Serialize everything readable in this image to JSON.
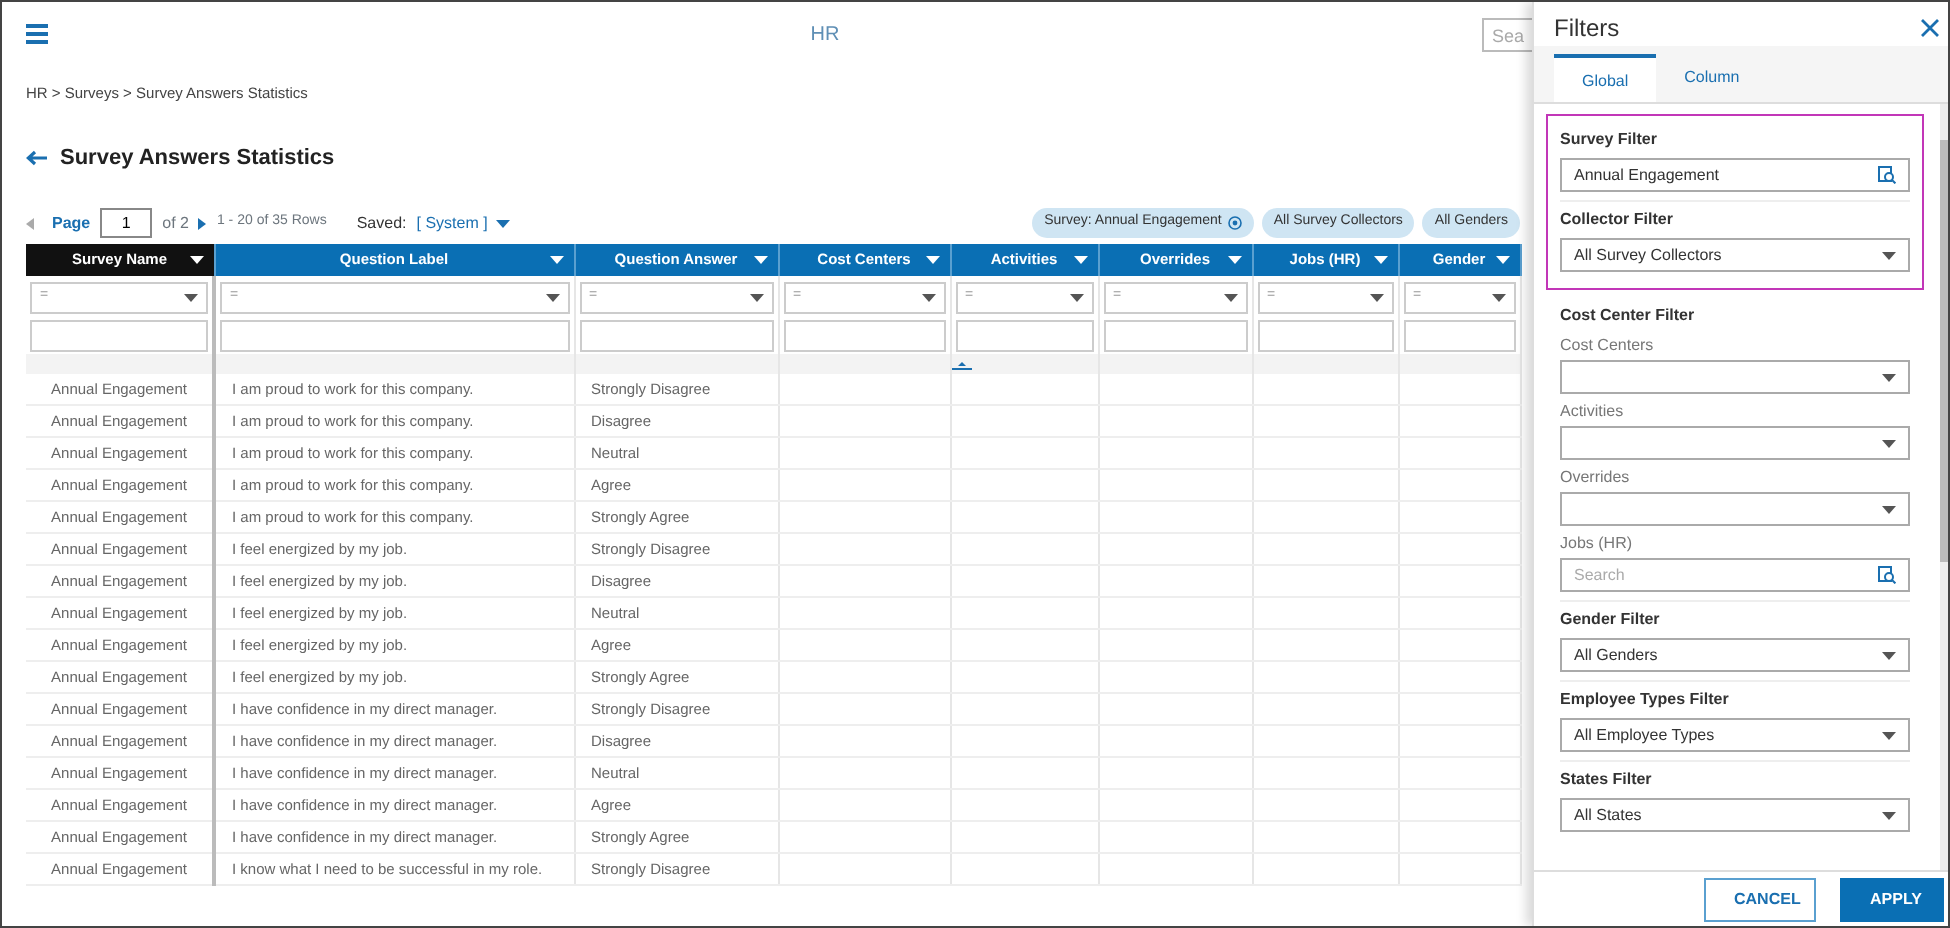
{
  "header": {
    "title": "HR",
    "search": {
      "placeholder": "Sea"
    }
  },
  "breadcrumb": "HR > Surveys > Survey Answers Statistics",
  "page_title": "Survey Answers Statistics",
  "pager": {
    "label": "Page",
    "page": "1",
    "of": "of 2",
    "rows": "1 - 20 of 35 Rows",
    "saved_label": "Saved:",
    "saved_value": "[ System ]"
  },
  "chips": [
    {
      "label": "Survey: Annual Engagement",
      "removable": true
    },
    {
      "label": "All Survey Collectors",
      "removable": false
    },
    {
      "label": "All Genders",
      "removable": false
    }
  ],
  "table": {
    "columns": [
      {
        "label": "Survey Name",
        "selected": true,
        "operator": "="
      },
      {
        "label": "Question Label",
        "selected": false,
        "operator": "="
      },
      {
        "label": "Question Answer",
        "selected": false,
        "operator": "="
      },
      {
        "label": "Cost Centers",
        "selected": false,
        "operator": "="
      },
      {
        "label": "Activities",
        "selected": false,
        "operator": "="
      },
      {
        "label": "Overrides",
        "selected": false,
        "operator": "="
      },
      {
        "label": "Jobs (HR)",
        "selected": false,
        "operator": "="
      },
      {
        "label": "Gender",
        "selected": false,
        "operator": "="
      }
    ],
    "rows": [
      [
        "Annual Engagement",
        "I am proud to work for this company.",
        "Strongly Disagree"
      ],
      [
        "Annual Engagement",
        "I am proud to work for this company.",
        "Disagree"
      ],
      [
        "Annual Engagement",
        "I am proud to work for this company.",
        "Neutral"
      ],
      [
        "Annual Engagement",
        "I am proud to work for this company.",
        "Agree"
      ],
      [
        "Annual Engagement",
        "I am proud to work for this company.",
        "Strongly Agree"
      ],
      [
        "Annual Engagement",
        "I feel energized by my job.",
        "Strongly Disagree"
      ],
      [
        "Annual Engagement",
        "I feel energized by my job.",
        "Disagree"
      ],
      [
        "Annual Engagement",
        "I feel energized by my job.",
        "Neutral"
      ],
      [
        "Annual Engagement",
        "I feel energized by my job.",
        "Agree"
      ],
      [
        "Annual Engagement",
        "I feel energized by my job.",
        "Strongly Agree"
      ],
      [
        "Annual Engagement",
        "I have confidence in my direct manager.",
        "Strongly Disagree"
      ],
      [
        "Annual Engagement",
        "I have confidence in my direct manager.",
        "Disagree"
      ],
      [
        "Annual Engagement",
        "I have confidence in my direct manager.",
        "Neutral"
      ],
      [
        "Annual Engagement",
        "I have confidence in my direct manager.",
        "Agree"
      ],
      [
        "Annual Engagement",
        "I have confidence in my direct manager.",
        "Strongly Agree"
      ],
      [
        "Annual Engagement",
        "I know what I need to be successful in my role.",
        "Strongly Disagree"
      ]
    ]
  },
  "filters_panel": {
    "title": "Filters",
    "tabs": [
      {
        "label": "Global",
        "selected": true
      },
      {
        "label": "Column",
        "selected": false
      }
    ],
    "highlighted_sections": [
      {
        "heading": "Survey Filter",
        "fields": [
          {
            "kind": "search",
            "value": "Annual Engagement"
          }
        ]
      },
      {
        "heading": "Collector Filter",
        "fields": [
          {
            "kind": "select",
            "value": "All Survey Collectors"
          }
        ]
      }
    ],
    "sections": [
      {
        "heading": "Cost Center Filter",
        "fields": [
          {
            "kind": "select",
            "label": "Cost Centers"
          },
          {
            "kind": "select",
            "label": "Activities"
          },
          {
            "kind": "select",
            "label": "Overrides"
          },
          {
            "kind": "search",
            "label": "Jobs (HR)",
            "placeholder": "Search"
          }
        ]
      },
      {
        "heading": "Gender Filter",
        "fields": [
          {
            "kind": "select",
            "value": "All Genders"
          }
        ]
      },
      {
        "heading": "Employee Types Filter",
        "fields": [
          {
            "kind": "select",
            "value": "All Employee Types"
          }
        ]
      },
      {
        "heading": "States Filter",
        "fields": [
          {
            "kind": "select",
            "value": "All States"
          }
        ]
      }
    ],
    "buttons": [
      {
        "label": "CANCEL",
        "kind": "secondary"
      },
      {
        "label": "APPLY",
        "kind": "primary"
      }
    ]
  }
}
